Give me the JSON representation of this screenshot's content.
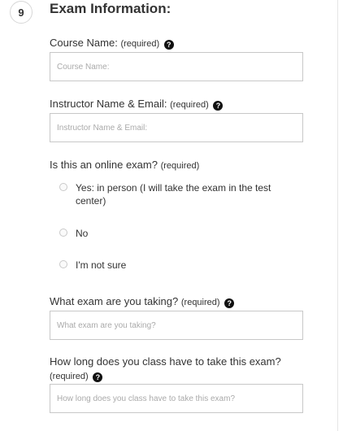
{
  "section": {
    "step_number": "9",
    "title": "Exam Information:"
  },
  "fields": {
    "course_name": {
      "label": "Course Name:",
      "required": "(required)",
      "help_icon": "question-circle-icon",
      "value": "",
      "placeholder": "Course Name:"
    },
    "instructor": {
      "label": "Instructor Name & Email:",
      "required": "(required)",
      "help_icon": "question-circle-icon",
      "value": "",
      "placeholder": "Instructor Name & Email:"
    },
    "online_exam": {
      "label": "Is this an online exam?",
      "required": "(required)",
      "options": [
        {
          "label_line1": "Yes: in person (I will take the exam in the test",
          "label_line2": "center)",
          "selected": false
        },
        {
          "label_line1": "No",
          "selected": false
        },
        {
          "label_line1": "I'm not sure",
          "selected": false
        }
      ]
    },
    "exam_taking": {
      "label": "What exam are you taking?",
      "required": "(required)",
      "help_icon": "question-circle-icon",
      "value": "",
      "placeholder": "What exam are you taking?"
    },
    "time_allowed": {
      "label": "How long does you class have to take this exam?",
      "required": "(required)",
      "help_icon": "question-circle-icon",
      "value": "",
      "placeholder": "How long does you class have to take this exam?"
    }
  },
  "colors": {
    "text": "#333333",
    "border": "#c8c8c8",
    "placeholder": "#aaaaaa"
  }
}
